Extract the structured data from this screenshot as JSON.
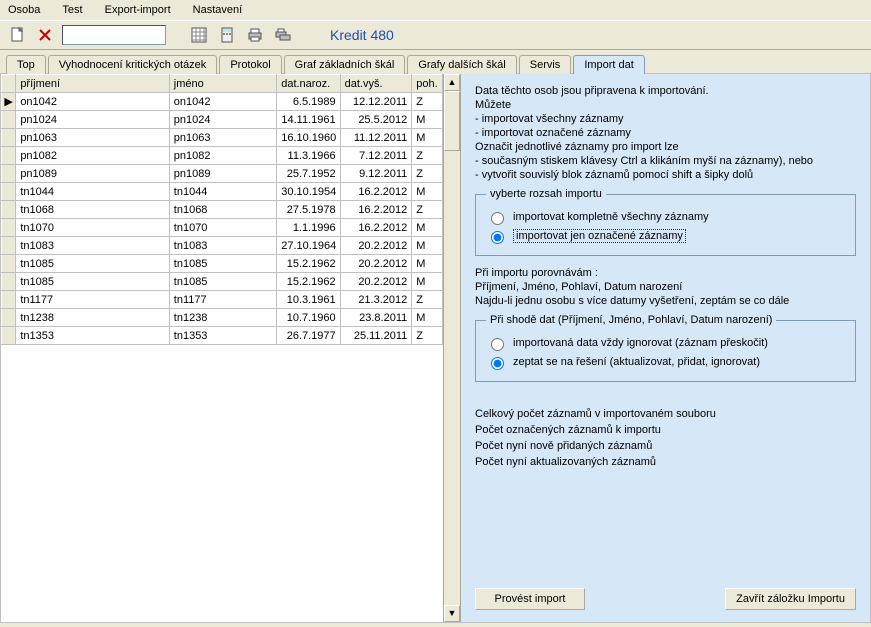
{
  "menu": [
    "Osoba",
    "Test",
    "Export-import",
    "Nastavení"
  ],
  "toolbar": {
    "input_value": "",
    "kredit_label": "Kredit 480"
  },
  "tabs": [
    {
      "label": "Top",
      "active": false
    },
    {
      "label": "Vyhodnocení kritických otázek",
      "active": false
    },
    {
      "label": "Protokol",
      "active": false
    },
    {
      "label": "Graf základních škál",
      "active": false
    },
    {
      "label": "Grafy dalších škál",
      "active": false
    },
    {
      "label": "Servis",
      "active": false
    },
    {
      "label": "Import dat",
      "active": true
    }
  ],
  "grid": {
    "headers": [
      "příjmení",
      "jméno",
      "dat.naroz.",
      "dat.vyš.",
      "poh."
    ],
    "rows": [
      {
        "marker": "▶",
        "prijmeni": "on1042",
        "jmeno": "on1042",
        "naroz": "6.5.1989",
        "vys": "12.12.2011",
        "poh": "Z"
      },
      {
        "marker": "",
        "prijmeni": "pn1024",
        "jmeno": "pn1024",
        "naroz": "14.11.1961",
        "vys": "25.5.2012",
        "poh": "M"
      },
      {
        "marker": "",
        "prijmeni": "pn1063",
        "jmeno": "pn1063",
        "naroz": "16.10.1960",
        "vys": "11.12.2011",
        "poh": "M"
      },
      {
        "marker": "",
        "prijmeni": "pn1082",
        "jmeno": "pn1082",
        "naroz": "11.3.1966",
        "vys": "7.12.2011",
        "poh": "Z"
      },
      {
        "marker": "",
        "prijmeni": "pn1089",
        "jmeno": "pn1089",
        "naroz": "25.7.1952",
        "vys": "9.12.2011",
        "poh": "Z"
      },
      {
        "marker": "",
        "prijmeni": "tn1044",
        "jmeno": "tn1044",
        "naroz": "30.10.1954",
        "vys": "16.2.2012",
        "poh": "M"
      },
      {
        "marker": "",
        "prijmeni": "tn1068",
        "jmeno": "tn1068",
        "naroz": "27.5.1978",
        "vys": "16.2.2012",
        "poh": "Z"
      },
      {
        "marker": "",
        "prijmeni": "tn1070",
        "jmeno": "tn1070",
        "naroz": "1.1.1996",
        "vys": "16.2.2012",
        "poh": "M"
      },
      {
        "marker": "",
        "prijmeni": "tn1083",
        "jmeno": "tn1083",
        "naroz": "27.10.1964",
        "vys": "20.2.2012",
        "poh": "M"
      },
      {
        "marker": "",
        "prijmeni": "tn1085",
        "jmeno": "tn1085",
        "naroz": "15.2.1962",
        "vys": "20.2.2012",
        "poh": "M"
      },
      {
        "marker": "",
        "prijmeni": "tn1085",
        "jmeno": "tn1085",
        "naroz": "15.2.1962",
        "vys": "20.2.2012",
        "poh": "M"
      },
      {
        "marker": "",
        "prijmeni": "tn1177",
        "jmeno": "tn1177",
        "naroz": "10.3.1961",
        "vys": "21.3.2012",
        "poh": "Z"
      },
      {
        "marker": "",
        "prijmeni": "tn1238",
        "jmeno": "tn1238",
        "naroz": "10.7.1960",
        "vys": "23.8.2011",
        "poh": "M"
      },
      {
        "marker": "",
        "prijmeni": "tn1353",
        "jmeno": "tn1353",
        "naroz": "26.7.1977",
        "vys": "25.11.2011",
        "poh": "Z"
      }
    ]
  },
  "right": {
    "intro1": "Data těchto osob jsou připravena k importování.",
    "intro2": "Můžete",
    "intro_b1": "- importovat všechny záznamy",
    "intro_b2": "- importovat označené záznamy",
    "intro3": "Označit jednotlivé záznamy pro import lze",
    "intro_b3": "- současným stiskem klávesy Ctrl a klikáním myší na záznamy), nebo",
    "intro_b4": "- vytvořit souvislý blok záznamů pomocí shift a šipky dolů",
    "group1_title": "vyberte rozsah importu",
    "group1_opt1": "importovat kompletně všechny záznamy",
    "group1_opt2": "importovat jen označené záznamy",
    "cmp1": "Při importu porovnávám :",
    "cmp2": "Příjmení, Jméno, Pohlaví, Datum narození",
    "cmp3": "Najdu-li jednu osobu s více datumy vyšetření, zeptám se co dále",
    "group2_title": "Při shodě dat (Příjmení, Jméno, Pohlaví, Datum narození)",
    "group2_opt1": "importovaná data vždy ignorovat (záznam přeskočit)",
    "group2_opt2": "zeptat se na řešení (aktualizovat, přidat, ignorovat)",
    "stat1": "Celkový počet záznamů v importovaném souboru",
    "stat2": "Počet označených záznamů k importu",
    "stat3": "Počet nyní nově přidaných záznamů",
    "stat4": "Počet nyní aktualizovaných záznamů",
    "btn_import": "Provést import",
    "btn_close": "Zavřít záložku Importu"
  }
}
